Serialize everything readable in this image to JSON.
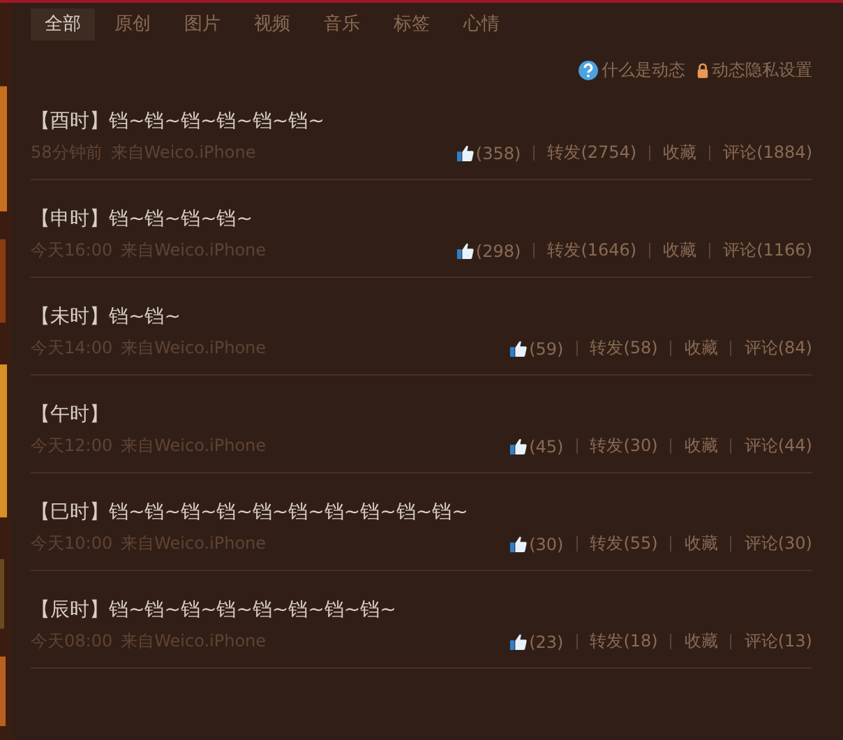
{
  "tabs": [
    {
      "label": "全部",
      "selected": true
    },
    {
      "label": "原创",
      "selected": false
    },
    {
      "label": "图片",
      "selected": false
    },
    {
      "label": "视频",
      "selected": false
    },
    {
      "label": "音乐",
      "selected": false
    },
    {
      "label": "标签",
      "selected": false
    },
    {
      "label": "心情",
      "selected": false
    }
  ],
  "links": [
    {
      "kind": "help",
      "label": "什么是动态"
    },
    {
      "kind": "privacy",
      "label": "动态隐私设置"
    }
  ],
  "posts": [
    {
      "text": "【酉时】铛~铛~铛~铛~铛~铛~",
      "time": "58分钟前",
      "source": "来自Weico.iPhone",
      "likes": "(358)",
      "repost": "转发(2754)",
      "favorite": "收藏",
      "comment": "评论(1884)"
    },
    {
      "text": "【申时】铛~铛~铛~铛~",
      "time": "今天16:00",
      "source": "来自Weico.iPhone",
      "likes": "(298)",
      "repost": "转发(1646)",
      "favorite": "收藏",
      "comment": "评论(1166)"
    },
    {
      "text": "【未时】铛~铛~",
      "time": "今天14:00",
      "source": "来自Weico.iPhone",
      "likes": "(59)",
      "repost": "转发(58)",
      "favorite": "收藏",
      "comment": "评论(84)"
    },
    {
      "text": "【午时】",
      "time": "今天12:00",
      "source": "来自Weico.iPhone",
      "likes": "(45)",
      "repost": "转发(30)",
      "favorite": "收藏",
      "comment": "评论(44)"
    },
    {
      "text": "【巳时】铛~铛~铛~铛~铛~铛~铛~铛~铛~铛~",
      "time": "今天10:00",
      "source": "来自Weico.iPhone",
      "likes": "(30)",
      "repost": "转发(55)",
      "favorite": "收藏",
      "comment": "评论(30)"
    },
    {
      "text": "【辰时】铛~铛~铛~铛~铛~铛~铛~铛~",
      "time": "今天08:00",
      "source": "来自Weico.iPhone",
      "likes": "(23)",
      "repost": "转发(18)",
      "favorite": "收藏",
      "comment": "评论(13)"
    }
  ]
}
